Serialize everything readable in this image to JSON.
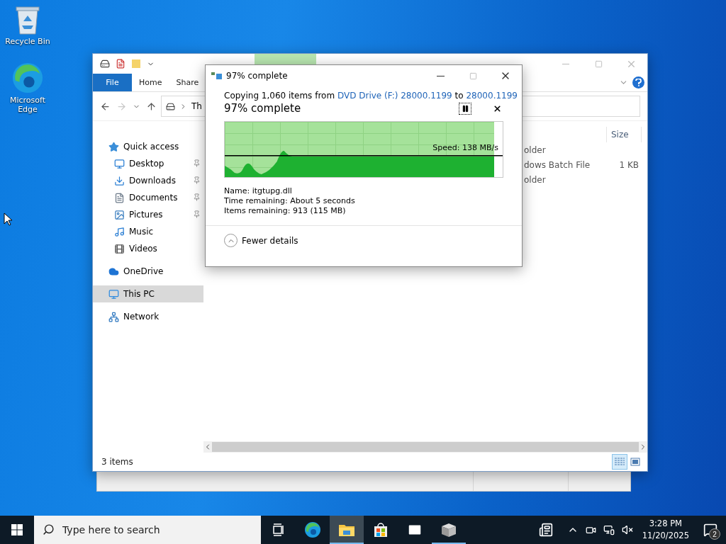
{
  "desktop_icons": [
    {
      "label": "Recycle Bin",
      "kind": "bin"
    },
    {
      "label": "Microsoft Edge",
      "kind": "edge"
    }
  ],
  "explorer": {
    "ribbon_tabs": [
      {
        "label": "File",
        "kind": "file"
      },
      {
        "label": "Home",
        "kind": "tab"
      },
      {
        "label": "Share",
        "kind": "tab"
      }
    ],
    "address": "Th",
    "nav": [
      {
        "label": "Quick access",
        "kind": "star",
        "selected": false,
        "children": [
          {
            "label": "Desktop",
            "kind": "desktop",
            "pinned": true,
            "selected": false
          },
          {
            "label": "Downloads",
            "kind": "download",
            "pinned": true,
            "selected": false
          },
          {
            "label": "Documents",
            "kind": "documents",
            "pinned": true,
            "selected": false
          },
          {
            "label": "Pictures",
            "kind": "pictures",
            "pinned": true,
            "selected": false
          },
          {
            "label": "Music",
            "kind": "music",
            "pinned": false,
            "selected": false
          },
          {
            "label": "Videos",
            "kind": "videos",
            "pinned": false,
            "selected": false
          }
        ]
      },
      {
        "label": "OneDrive",
        "kind": "cloud",
        "selected": false
      },
      {
        "label": "This PC",
        "kind": "pc",
        "selected": true
      },
      {
        "label": "Network",
        "kind": "network",
        "selected": false
      }
    ],
    "columns": [
      "Size"
    ],
    "rows": [
      {
        "type": "older"
      },
      {
        "type": "dows Batch File",
        "size": "1 KB"
      },
      {
        "type": "older"
      }
    ],
    "status": "3 items"
  },
  "dialog": {
    "title": "97% complete",
    "copying": {
      "prefix": "Copying 1,060 items from",
      "source": "DVD Drive (F:) 28000.1199",
      "middle": "to",
      "target": "28000.1199"
    },
    "heading": "97% complete",
    "level": 0.97,
    "speed": "Speed: 138 MB/s",
    "details": [
      {
        "label": "Name:",
        "value": "itgtupg.dll"
      },
      {
        "label": "Time remaining:",
        "value": "About 5 seconds"
      },
      {
        "label": "Items remaining:",
        "value": "913 (115 MB)"
      }
    ],
    "toggle": "Fewer details"
  },
  "taskbar": {
    "search_placeholder": "Type here to search",
    "apps": [
      {
        "kind": "taskview",
        "running": false,
        "active": false
      },
      {
        "kind": "edge",
        "running": false,
        "active": false
      },
      {
        "kind": "explorer",
        "running": true,
        "active": true
      },
      {
        "kind": "store",
        "running": false,
        "active": false
      },
      {
        "kind": "mail",
        "running": false,
        "active": false
      },
      {
        "kind": "installer",
        "running": true,
        "active": false
      }
    ],
    "time": "3:28 PM",
    "date": "11/20/2025",
    "notifications": "2"
  }
}
